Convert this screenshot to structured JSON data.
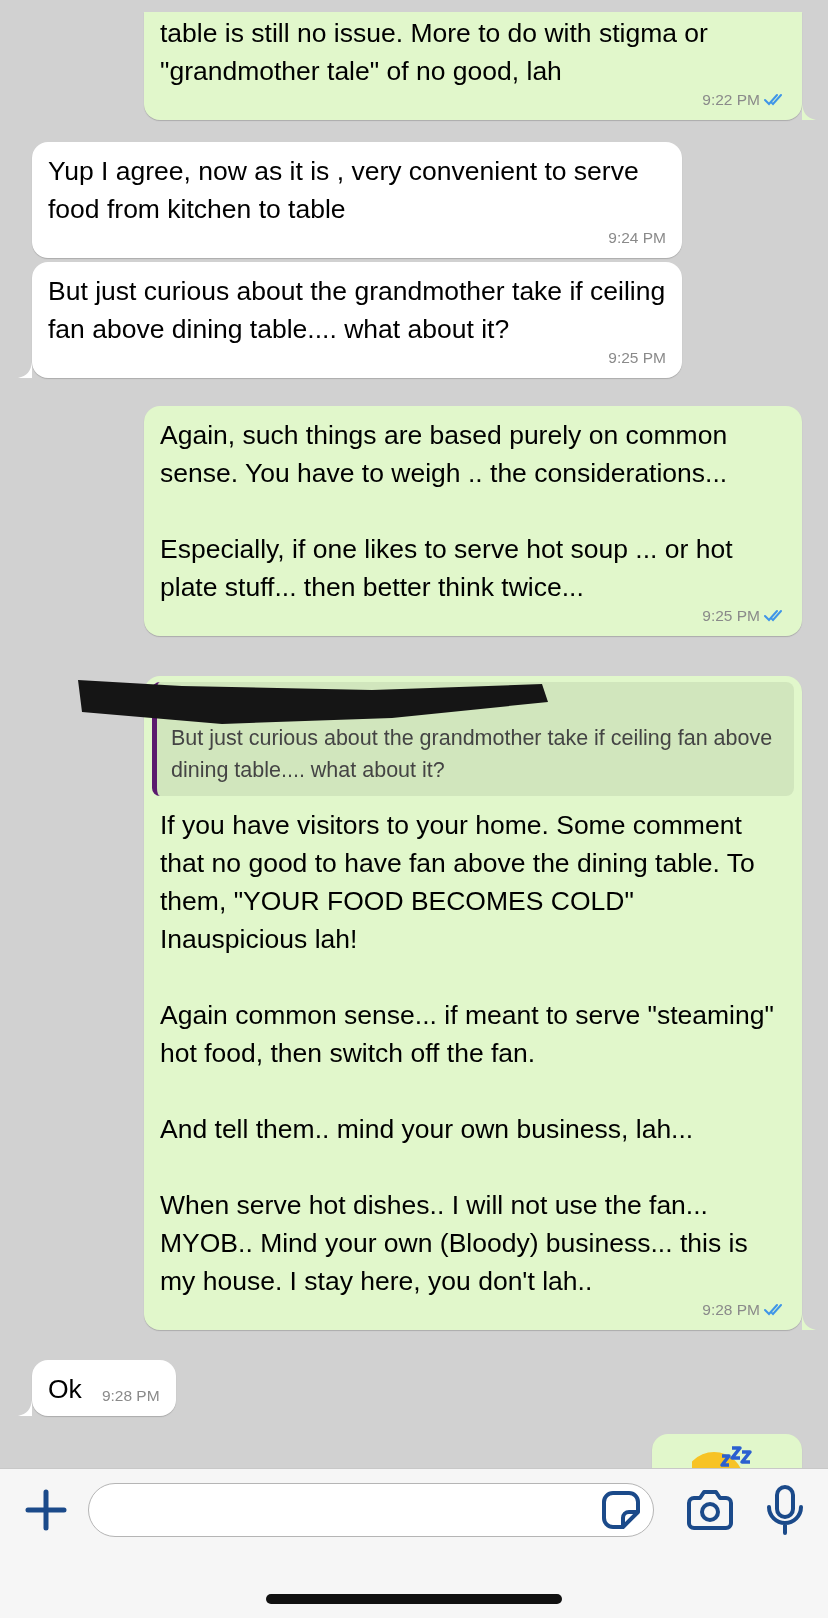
{
  "messages": [
    {
      "kind": "outgoing_text",
      "tail": true,
      "paragraphs": [
        "table is still no issue. More to do with stigma or \"grandmother tale\" of no good, lah"
      ],
      "time": "9:22 PM",
      "read": true
    },
    {
      "kind": "incoming_text",
      "tail": false,
      "paragraphs": [
        "Yup I agree, now as it is , very convenient to serve food from kitchen to table"
      ],
      "time": "9:24 PM"
    },
    {
      "kind": "incoming_text",
      "tail": true,
      "paragraphs": [
        "But just curious about the grandmother take if ceiling fan above dining table.... what about it?"
      ],
      "time": "9:25 PM"
    },
    {
      "kind": "outgoing_text",
      "tail": false,
      "paragraphs": [
        "Again, such things are based purely on common sense. You have to weigh .. the considerations...",
        "Especially, if one likes to serve hot soup ... or hot plate stuff... then better think twice..."
      ],
      "time": "9:25 PM",
      "read": true
    },
    {
      "kind": "outgoing_text",
      "tail": true,
      "quote": {
        "redacted": true,
        "text": "But just curious about the grandmother take if ceiling fan above dining table.... what about it?"
      },
      "paragraphs": [
        "If you have visitors to your home. Some comment that no good to have fan above the dining table. To them, \"YOUR FOOD BECOMES COLD\" Inauspicious lah!",
        "Again common sense... if meant to serve \"steaming\" hot food, then switch off the fan.",
        "And tell them.. mind your own business, lah...",
        "When serve hot dishes.. I will not use the fan... MYOB.. Mind your own (Bloody) business... this is my house. I stay here, you don't lah.."
      ],
      "time": "9:28 PM",
      "read": true
    },
    {
      "kind": "incoming_text",
      "tail": true,
      "paragraphs": [
        "Ok"
      ],
      "time": "9:28 PM"
    },
    {
      "kind": "outgoing_sticker"
    }
  ]
}
